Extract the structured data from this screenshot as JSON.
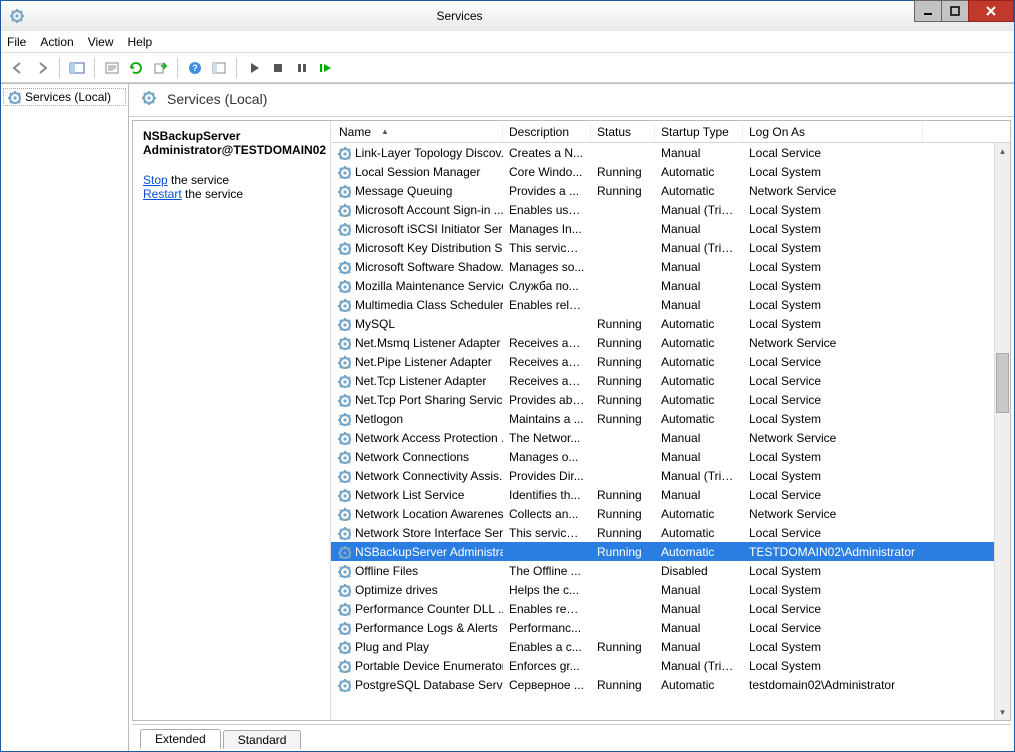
{
  "window": {
    "title": "Services"
  },
  "menu": {
    "file": "File",
    "action": "Action",
    "view": "View",
    "help": "Help"
  },
  "tree": {
    "root_label": "Services (Local)"
  },
  "header": {
    "title": "Services (Local)"
  },
  "detail": {
    "selected_name": "NSBackupServer Administrator@TESTDOMAIN02",
    "stop_label": "Stop",
    "stop_suffix": " the service",
    "restart_label": "Restart",
    "restart_suffix": " the service"
  },
  "columns": {
    "name": "Name",
    "description": "Description",
    "status": "Status",
    "startup": "Startup Type",
    "logon": "Log On As"
  },
  "tabs": {
    "extended": "Extended",
    "standard": "Standard"
  },
  "services": [
    {
      "name": "Link-Layer Topology Discov...",
      "desc": "Creates a N...",
      "status": "",
      "startup": "Manual",
      "logon": "Local Service"
    },
    {
      "name": "Local Session Manager",
      "desc": "Core Windo...",
      "status": "Running",
      "startup": "Automatic",
      "logon": "Local System"
    },
    {
      "name": "Message Queuing",
      "desc": "Provides a ...",
      "status": "Running",
      "startup": "Automatic",
      "logon": "Network Service"
    },
    {
      "name": "Microsoft Account Sign-in ...",
      "desc": "Enables use...",
      "status": "",
      "startup": "Manual (Trig...",
      "logon": "Local System"
    },
    {
      "name": "Microsoft iSCSI Initiator Ser...",
      "desc": "Manages In...",
      "status": "",
      "startup": "Manual",
      "logon": "Local System"
    },
    {
      "name": "Microsoft Key Distribution S...",
      "desc": "This service ...",
      "status": "",
      "startup": "Manual (Trig...",
      "logon": "Local System"
    },
    {
      "name": "Microsoft Software Shadow...",
      "desc": "Manages so...",
      "status": "",
      "startup": "Manual",
      "logon": "Local System"
    },
    {
      "name": "Mozilla Maintenance Service",
      "desc": "Служба по...",
      "status": "",
      "startup": "Manual",
      "logon": "Local System"
    },
    {
      "name": "Multimedia Class Scheduler",
      "desc": "Enables rela...",
      "status": "",
      "startup": "Manual",
      "logon": "Local System"
    },
    {
      "name": "MySQL",
      "desc": "",
      "status": "Running",
      "startup": "Automatic",
      "logon": "Local System"
    },
    {
      "name": "Net.Msmq Listener Adapter",
      "desc": "Receives act...",
      "status": "Running",
      "startup": "Automatic",
      "logon": "Network Service"
    },
    {
      "name": "Net.Pipe Listener Adapter",
      "desc": "Receives act...",
      "status": "Running",
      "startup": "Automatic",
      "logon": "Local Service"
    },
    {
      "name": "Net.Tcp Listener Adapter",
      "desc": "Receives act...",
      "status": "Running",
      "startup": "Automatic",
      "logon": "Local Service"
    },
    {
      "name": "Net.Tcp Port Sharing Service",
      "desc": "Provides abi...",
      "status": "Running",
      "startup": "Automatic",
      "logon": "Local Service"
    },
    {
      "name": "Netlogon",
      "desc": "Maintains a ...",
      "status": "Running",
      "startup": "Automatic",
      "logon": "Local System"
    },
    {
      "name": "Network Access Protection ...",
      "desc": "The Networ...",
      "status": "",
      "startup": "Manual",
      "logon": "Network Service"
    },
    {
      "name": "Network Connections",
      "desc": "Manages o...",
      "status": "",
      "startup": "Manual",
      "logon": "Local System"
    },
    {
      "name": "Network Connectivity Assis...",
      "desc": "Provides Dir...",
      "status": "",
      "startup": "Manual (Trig...",
      "logon": "Local System"
    },
    {
      "name": "Network List Service",
      "desc": "Identifies th...",
      "status": "Running",
      "startup": "Manual",
      "logon": "Local Service"
    },
    {
      "name": "Network Location Awareness",
      "desc": "Collects an...",
      "status": "Running",
      "startup": "Automatic",
      "logon": "Network Service"
    },
    {
      "name": "Network Store Interface Ser...",
      "desc": "This service ...",
      "status": "Running",
      "startup": "Automatic",
      "logon": "Local Service"
    },
    {
      "name": "NSBackupServer Administra...",
      "desc": "",
      "status": "Running",
      "startup": "Automatic",
      "logon": "TESTDOMAIN02\\Administrator",
      "selected": true
    },
    {
      "name": "Offline Files",
      "desc": "The Offline ...",
      "status": "",
      "startup": "Disabled",
      "logon": "Local System"
    },
    {
      "name": "Optimize drives",
      "desc": "Helps the c...",
      "status": "",
      "startup": "Manual",
      "logon": "Local System"
    },
    {
      "name": "Performance Counter DLL ...",
      "desc": "Enables rem...",
      "status": "",
      "startup": "Manual",
      "logon": "Local Service"
    },
    {
      "name": "Performance Logs & Alerts",
      "desc": "Performanc...",
      "status": "",
      "startup": "Manual",
      "logon": "Local Service"
    },
    {
      "name": "Plug and Play",
      "desc": "Enables a c...",
      "status": "Running",
      "startup": "Manual",
      "logon": "Local System"
    },
    {
      "name": "Portable Device Enumerator...",
      "desc": "Enforces gr...",
      "status": "",
      "startup": "Manual (Trig...",
      "logon": "Local System"
    },
    {
      "name": "PostgreSQL Database Server...",
      "desc": "Серверное ...",
      "status": "Running",
      "startup": "Automatic",
      "logon": "testdomain02\\Administrator"
    }
  ]
}
